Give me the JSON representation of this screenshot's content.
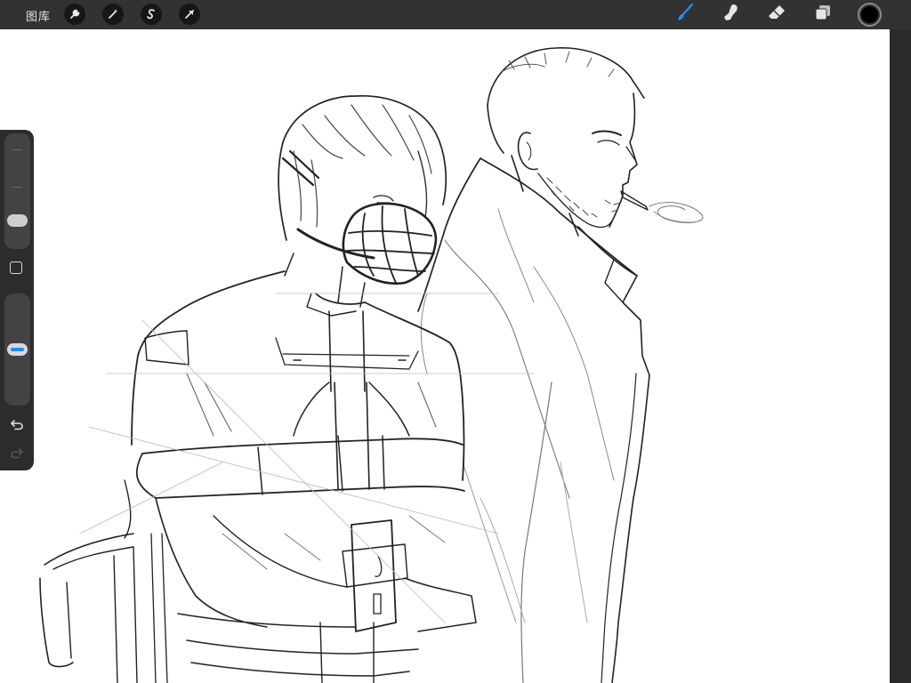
{
  "toolbar": {
    "gallery_label": "图库",
    "left_tools": [
      {
        "name": "actions",
        "icon": "wrench-icon"
      },
      {
        "name": "adjustments",
        "icon": "magic-wand-icon"
      },
      {
        "name": "selection",
        "icon": "selection-s-icon"
      },
      {
        "name": "transform",
        "icon": "transform-arrow-icon"
      }
    ],
    "right_tools": [
      {
        "name": "brush",
        "icon": "brush-icon",
        "active": true
      },
      {
        "name": "smudge",
        "icon": "smudge-finger-icon",
        "active": false
      },
      {
        "name": "eraser",
        "icon": "eraser-icon",
        "active": false
      },
      {
        "name": "layers",
        "icon": "layers-icon",
        "active": false
      }
    ],
    "current_color": "#000000",
    "accent_color": "#1e8ef5"
  },
  "sidebar": {
    "brush_size_level": 0.2,
    "brush_opacity_level": 0.5,
    "modify_icon": "square-icon",
    "undo_icon": "undo-icon",
    "redo_icon": "redo-icon",
    "redo_enabled": false
  },
  "canvas": {
    "background": "#ffffff",
    "content": "pencil sketch"
  }
}
